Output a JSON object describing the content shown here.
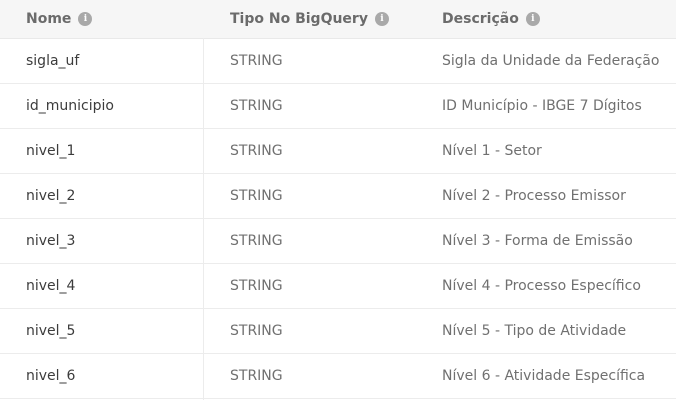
{
  "header": {
    "col_name": "Nome",
    "col_type": "Tipo No BigQuery",
    "col_desc": "Descrição",
    "info_icon_glyph": "i"
  },
  "rows": [
    {
      "name": "sigla_uf",
      "type": "STRING",
      "desc": "Sigla da Unidade da Federação"
    },
    {
      "name": "id_municipio",
      "type": "STRING",
      "desc": "ID Município - IBGE 7 Dígitos"
    },
    {
      "name": "nivel_1",
      "type": "STRING",
      "desc": "Nível 1 - Setor"
    },
    {
      "name": "nivel_2",
      "type": "STRING",
      "desc": "Nível 2 - Processo Emissor"
    },
    {
      "name": "nivel_3",
      "type": "STRING",
      "desc": "Nível 3 - Forma de Emissão"
    },
    {
      "name": "nivel_4",
      "type": "STRING",
      "desc": "Nível 4 - Processo Específico"
    },
    {
      "name": "nivel_5",
      "type": "STRING",
      "desc": "Nível 5 - Tipo de Atividade"
    },
    {
      "name": "nivel_6",
      "type": "STRING",
      "desc": "Nível 6 - Atividade Específica"
    }
  ],
  "colors": {
    "header_bg": "#f6f6f6",
    "header_text": "#6b6b6b",
    "info_icon": "#a9a9a9",
    "cell_text": "#3c3c3c",
    "divider": "#ececec"
  }
}
